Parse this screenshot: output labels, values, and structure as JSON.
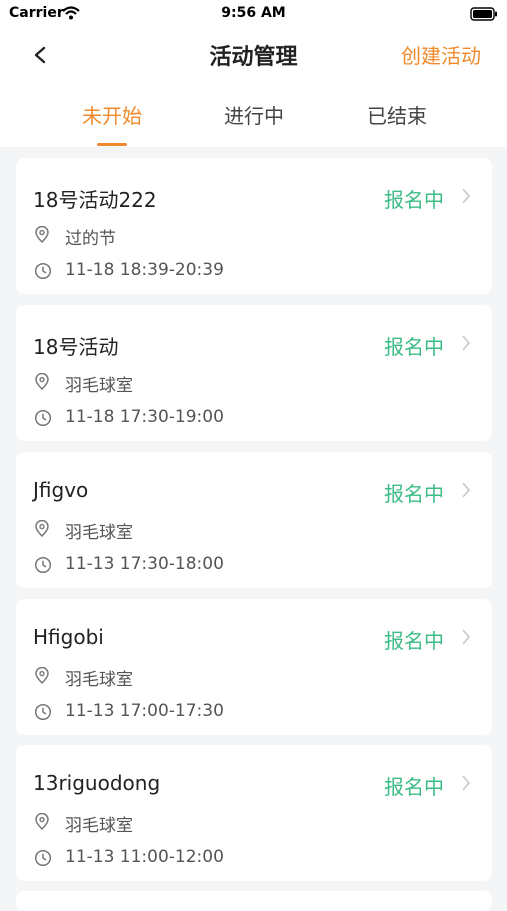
{
  "status_bar": {
    "carrier": "Carrier",
    "time": "9:56 AM"
  },
  "nav": {
    "title": "活动管理",
    "create_label": "创建活动"
  },
  "tabs": [
    {
      "label": "未开始",
      "active": true
    },
    {
      "label": "进行中",
      "active": false
    },
    {
      "label": "已结束",
      "active": false
    }
  ],
  "activities": [
    {
      "title": "18号活动222",
      "status": "报名中",
      "location": "过的节",
      "time": "11-18 18:39-20:39"
    },
    {
      "title": "18号活动",
      "status": "报名中",
      "location": "羽毛球室",
      "time": "11-18 17:30-19:00"
    },
    {
      "title": "Jfigvo",
      "status": "报名中",
      "location": "羽毛球室",
      "time": "11-13 17:30-18:00"
    },
    {
      "title": "Hfigobi",
      "status": "报名中",
      "location": "羽毛球室",
      "time": "11-13 17:00-17:30"
    },
    {
      "title": "13riguodong",
      "status": "报名中",
      "location": "羽毛球室",
      "time": "11-13 11:00-12:00"
    }
  ],
  "colors": {
    "accent": "#f08a2c",
    "status_green": "#3dbc86",
    "background": "#f4f5f7"
  },
  "icons": [
    "wifi-icon",
    "battery-icon",
    "back-arrow-icon",
    "chevron-right-icon",
    "location-pin-icon",
    "clock-icon"
  ]
}
